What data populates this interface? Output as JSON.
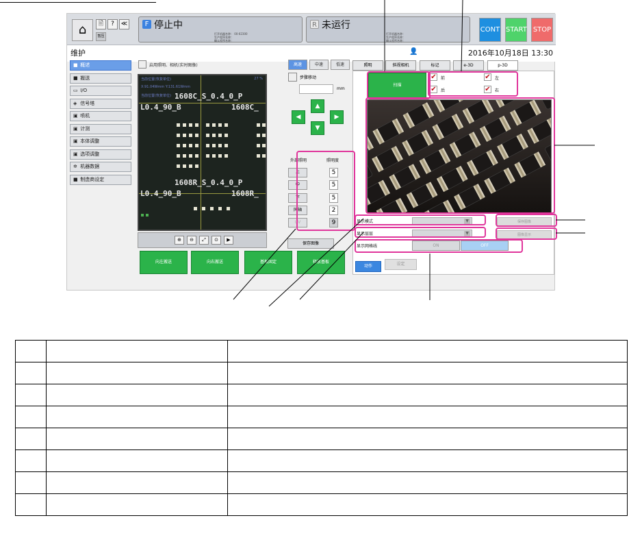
{
  "topbar": {
    "home_icon": "home-icon",
    "small_buttons": [
      "🖹",
      "?",
      "≪"
    ],
    "small_label": "暂压",
    "status_left": {
      "letter": "F",
      "title": "停止中",
      "meta": [
        "打开机器名称：  00-02300",
        "生产程序名称：",
        "确认程序名称："
      ]
    },
    "status_right": {
      "letter": "R",
      "title": "未运行",
      "meta": [
        "打开机器名称：",
        "生产程序名称：",
        "确认程序名称："
      ]
    },
    "cont": "CONT",
    "start": "START",
    "stop": "STOP",
    "colors": {
      "cont": "#1e8fe0",
      "start": "#4fd36b",
      "stop": "#ef6b6b"
    }
  },
  "header": {
    "title": "维护",
    "datetime": "2016年10月18日  13:30"
  },
  "sidebar": {
    "items": [
      {
        "label": "概述",
        "icon": "overview-icon",
        "active": true
      },
      {
        "label": "搬送",
        "icon": "conveyor-icon"
      },
      {
        "label": "I/O",
        "icon": "io-icon"
      },
      {
        "label": "信号塔",
        "icon": "signal-tower-icon"
      },
      {
        "label": "喷机",
        "icon": "machine-icon"
      },
      {
        "label": "计测",
        "icon": "measure-icon"
      },
      {
        "label": "本体调整",
        "icon": "adjust-icon"
      },
      {
        "label": "选项调整",
        "icon": "option-icon"
      },
      {
        "label": "机器数据",
        "icon": "gear-icon"
      },
      {
        "label": "制造商设定",
        "icon": "maker-icon"
      }
    ]
  },
  "camera": {
    "enable_label": "启用照明、相机(实时图像)",
    "overlay_top": "当前位置(恢复单位)",
    "overlay_pct": "27 %",
    "overlay_xy": "X:91.04Wmm Y:131.61Wmm",
    "overlay_pos2": "当前位置(恢复单位)",
    "labels": [
      "1608C_S_0.4_0_P",
      "L0.4_90_B",
      "1608C_",
      "1608R_S_0.4_0_P",
      "L0.4_90_B",
      "1608R_"
    ]
  },
  "zoom_icons": [
    "zoom-in-icon",
    "zoom-out-icon",
    "fit-icon",
    "zoom-reset-icon",
    "snapshot-icon"
  ],
  "speed": {
    "tabs": [
      "高速",
      "中速",
      "低速"
    ],
    "active": 0
  },
  "step": {
    "label": "步骤移动",
    "unit": "mm"
  },
  "arrows": {
    "up": "▲",
    "down": "▼",
    "left": "◀",
    "right": "▶"
  },
  "lighting": {
    "header_left": "外部照明",
    "header_right": "照明度",
    "rows": [
      {
        "label": "上",
        "value": "5"
      },
      {
        "label": "中",
        "value": "5"
      },
      {
        "label": "下",
        "value": "5"
      },
      {
        "label": "同轴",
        "value": "2"
      },
      {
        "label": "UV",
        "value": "9"
      }
    ]
  },
  "save_image": "保存图像",
  "green_buttons": [
    "向左搬送",
    "向右搬送",
    "基板固定",
    "释放基板"
  ],
  "right": {
    "tabs": [
      "照明",
      "斜视相机",
      "标记",
      "e-3D",
      "p-3D"
    ],
    "active_tab": 4,
    "scan": "扫描",
    "checks": [
      {
        "label": "前"
      },
      {
        "label": "左"
      },
      {
        "label": "后"
      },
      {
        "label": "右"
      }
    ],
    "check_mark": "✔",
    "display_mode": "显示模式",
    "display_layer": "显示层层",
    "display_grid": "显示网格线",
    "save_image": "保存图像",
    "image_display": "图像显示",
    "grid_on": "ON",
    "grid_off": "OFF",
    "action": "动作",
    "set": "设定"
  },
  "legend_rows": 8
}
